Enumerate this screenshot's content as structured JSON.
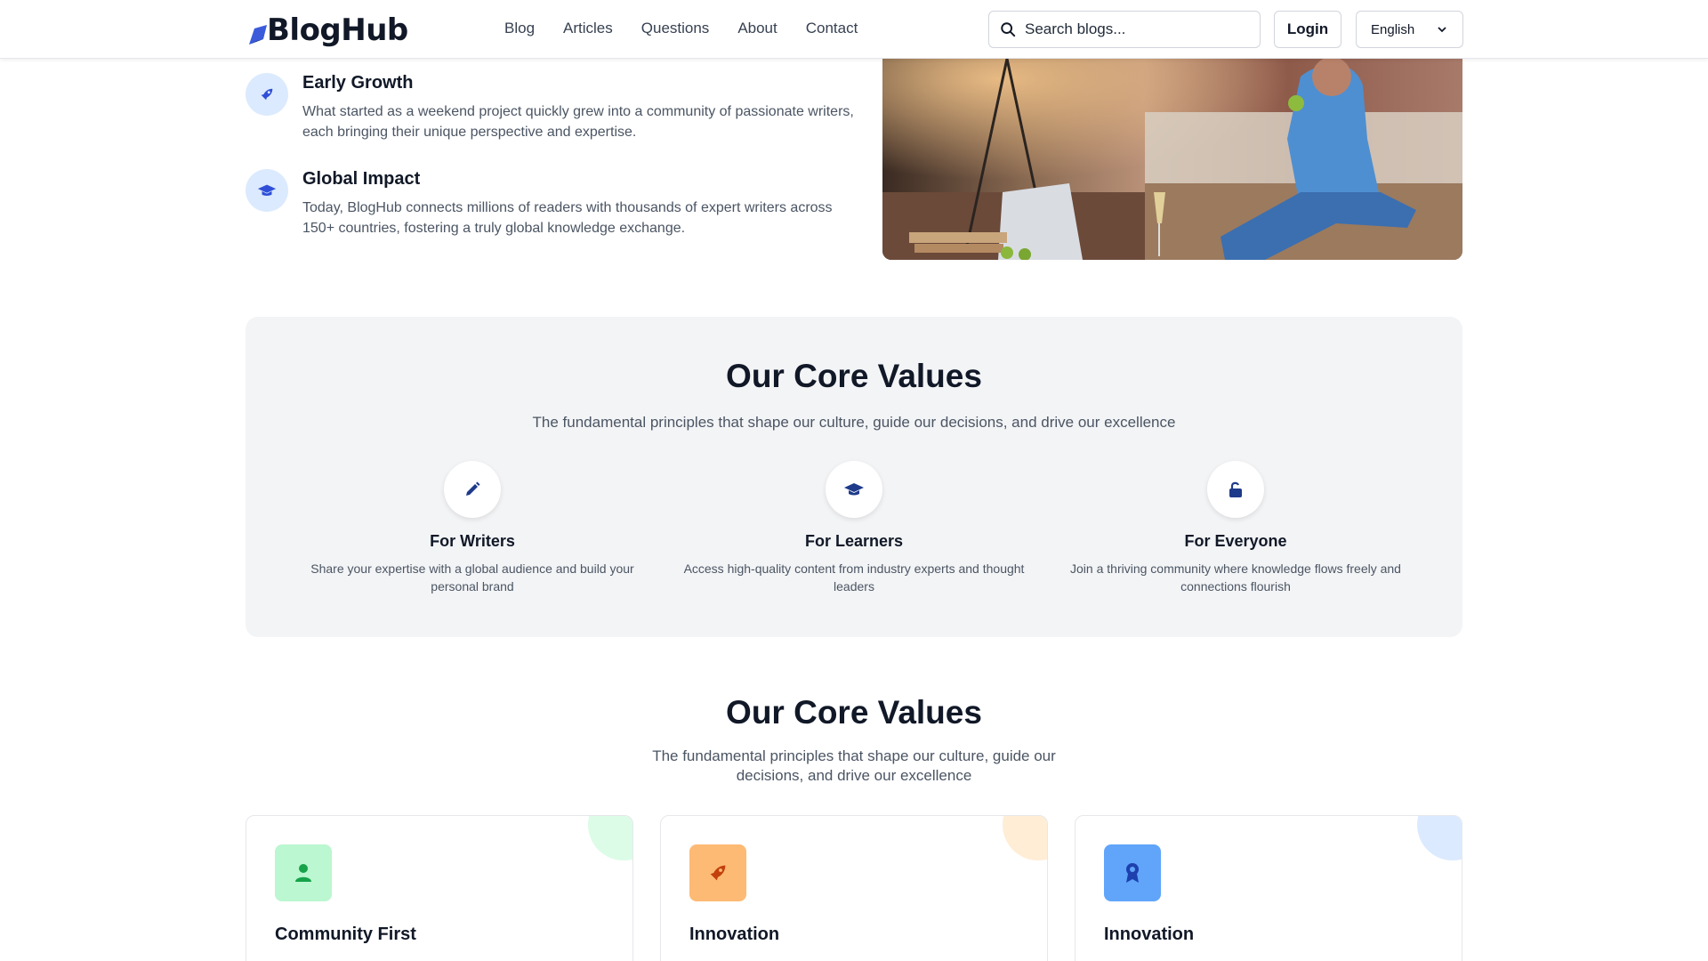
{
  "header": {
    "logo_text": "BlogHub",
    "nav": [
      "Blog",
      "Articles",
      "Questions",
      "About",
      "Contact"
    ],
    "search_placeholder": "Search blogs...",
    "login_label": "Login",
    "language": "English"
  },
  "timeline": [
    {
      "title": "Early Growth",
      "desc": "What started as a weekend project quickly grew into a community of passionate writers, each bringing their unique perspective and expertise.",
      "icon": "rocket-icon"
    },
    {
      "title": "Global Impact",
      "desc": "Today, BlogHub connects millions of readers with thousands of expert writers across 150+ countries, fostering a truly global knowledge exchange.",
      "icon": "graduation-cap-icon"
    }
  ],
  "values_section": {
    "title": "Our Core Values",
    "subtitle": "The fundamental principles that shape our culture, guide our decisions, and drive our excellence",
    "items": [
      {
        "title": "For Writers",
        "desc": "Share your expertise with a global audience and build your personal brand",
        "icon": "pencil-icon"
      },
      {
        "title": "For Learners",
        "desc": "Access high-quality content from industry experts and thought leaders",
        "icon": "graduation-cap-icon"
      },
      {
        "title": "For Everyone",
        "desc": "Join a thriving community where knowledge flows freely and connections flourish",
        "icon": "unlock-icon"
      }
    ]
  },
  "values_section2": {
    "title": "Our Core Values",
    "subtitle_line1": "The fundamental principles that shape our culture, guide our",
    "subtitle_line2": "decisions, and drive our excellence",
    "cards": [
      {
        "title": "Community First",
        "icon": "user-icon",
        "icon_bg": "#bbf7d0",
        "icon_color": "#16a34a",
        "blob": "#dcfce7"
      },
      {
        "title": "Innovation",
        "icon": "rocket-icon",
        "icon_bg": "#fdba74",
        "icon_color": "#c2410c",
        "blob": "#ffedd5"
      },
      {
        "title": "Innovation",
        "icon": "award-icon",
        "icon_bg": "#60a5fa",
        "icon_color": "#1e40af",
        "blob": "#dbeafe"
      }
    ]
  },
  "colors": {
    "accent": "#1e3a8a",
    "icon_circle_bg": "#dbeafe",
    "section_bg": "#f3f4f6"
  }
}
